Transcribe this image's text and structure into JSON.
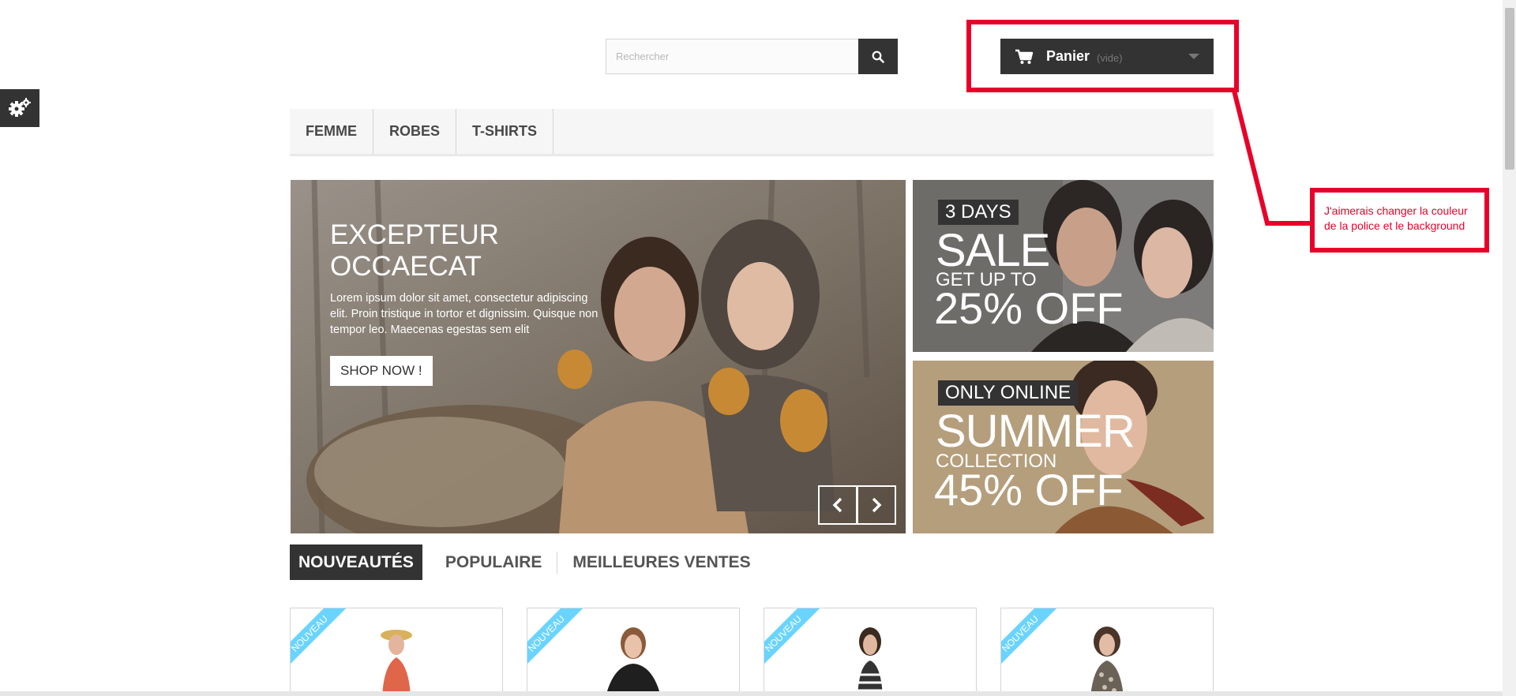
{
  "header": {
    "search_placeholder": "Rechercher",
    "cart_label": "Panier",
    "cart_status": "(vide)"
  },
  "menu": {
    "items": [
      "Femme",
      "Robes",
      "T-shirts"
    ]
  },
  "slider": {
    "title_line1": "EXCEPTEUR",
    "title_line2": "OCCAECAT",
    "text": "Lorem ipsum dolor sit amet, consectetur adipiscing elit. Proin tristique in tortor et dignissim. Quisque non tempor leo. Maecenas egestas sem elit",
    "button": "SHOP NOW !"
  },
  "banners": [
    {
      "tag": "3 DAYS",
      "big": "SALE",
      "small": "GET UP TO",
      "pct": "25% OFF"
    },
    {
      "tag": "ONLY ONLINE",
      "big": "SUMMER",
      "small": "COLLECTION",
      "pct": "45% OFF"
    }
  ],
  "tabs": {
    "items": [
      "Nouveautés",
      "Populaire",
      "Meilleures ventes"
    ],
    "active": "Nouveautés"
  },
  "products": {
    "ribbon": "Nouveau",
    "count_visible": 4
  },
  "annotation": {
    "note": "J'aimerais changer la couleur de la police et le background",
    "color": "#e8002a"
  },
  "colors": {
    "dark": "#333333",
    "ribbon": "#6ad4ff",
    "menu_bg": "#f6f6f6"
  }
}
